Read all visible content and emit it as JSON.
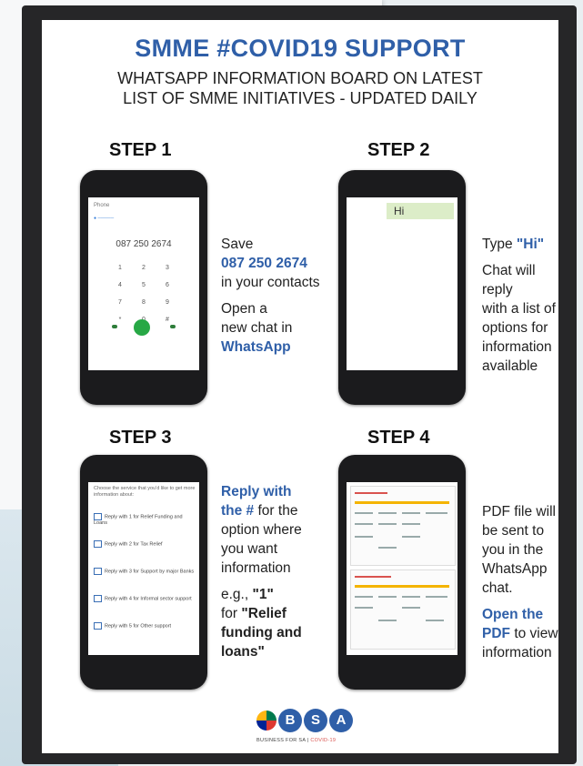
{
  "header": {
    "title": "SMME #COVID19 SUPPORT",
    "subtitle_line1": "WHATSAPP INFORMATION BOARD ON LATEST",
    "subtitle_line2": "LIST OF SMME INITIATIVES - UPDATED DAILY"
  },
  "steps": [
    {
      "label": "STEP 1",
      "text": {
        "save": "Save",
        "number": "087 250 2674",
        "in_contacts": "in your contacts",
        "open_a": "Open a",
        "new_chat_in": "new chat in",
        "app": "WhatsApp"
      },
      "phone": {
        "top_label": "Phone",
        "dial_number": "087 250 2674",
        "keys": [
          "1",
          "2",
          "3",
          "4",
          "5",
          "6",
          "7",
          "8",
          "9",
          "*",
          "0",
          "#"
        ]
      }
    },
    {
      "label": "STEP 2",
      "text": {
        "type": "Type",
        "hi_quoted": "\"Hi\"",
        "line1": "Chat will reply",
        "line2": "with a list of",
        "line3": "options for",
        "line4": "information",
        "line5": "available"
      },
      "phone": {
        "bubble": "Hi"
      }
    },
    {
      "label": "STEP 3",
      "text": {
        "reply_with": "Reply with",
        "the_hash": "the #",
        "for_the": "for the",
        "option_where": "option where",
        "you_want": "you want",
        "information": "information",
        "eg": "e.g.,",
        "eg_value": "\"1\"",
        "for": "for",
        "relief_line1": "\"Relief",
        "relief_line2": "funding and",
        "relief_line3": "loans\""
      },
      "phone": {
        "intro": "Choose the service that you'd like to get more information about:",
        "options": [
          "Reply with 1 for Relief Funding and Loans",
          "Reply with 2 for Tax Relief",
          "Reply with 3 for Support by major Banks",
          "Reply with 4 for Informal sector support",
          "Reply with 5 for Other support"
        ]
      }
    },
    {
      "label": "STEP 4",
      "text": {
        "line1": "PDF file will",
        "line2": "be sent to",
        "line3": "you in the",
        "line4": "WhatsApp",
        "line5": "chat.",
        "open_the": "Open the",
        "pdf": "PDF",
        "to_view": "to view",
        "information": "information"
      }
    }
  ],
  "logo": {
    "letters": [
      "B",
      "S",
      "A"
    ],
    "tagline_main": "BUSINESS FOR SA",
    "tagline_sep": " | ",
    "tagline_accent": "COVID-19"
  },
  "colors": {
    "brand_blue": "#2f5fa8",
    "whatsapp_green": "#27a845",
    "poster_frame": "#262628"
  }
}
